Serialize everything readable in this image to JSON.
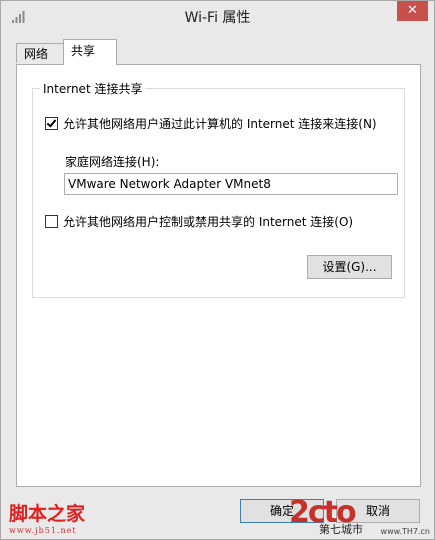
{
  "window": {
    "title": "Wi-Fi 属性",
    "close_glyph": "✕"
  },
  "tabs": [
    {
      "label": "网络"
    },
    {
      "label": "共享"
    }
  ],
  "group": {
    "title": "Internet 连接共享",
    "allow_share_label": "允许其他网络用户通过此计算机的 Internet 连接来连接(N)",
    "allow_share_checked": true,
    "home_network_label": "家庭网络连接(H):",
    "home_network_value": "VMware Network Adapter VMnet8",
    "allow_control_label": "允许其他网络用户控制或禁用共享的 Internet 连接(O)",
    "allow_control_checked": false,
    "settings_label": "设置(G)..."
  },
  "footer": {
    "ok_label": "确定",
    "cancel_label": "取消"
  },
  "watermarks": {
    "left_title": "脚本之家",
    "left_url": "www.jb51.net",
    "right_logo": "2cto",
    "right_sub": "第七城市",
    "right_site": "www.TH7.cn",
    "brand_red": "#c8302a"
  },
  "icons": {
    "title": "wifi-icon",
    "close": "close-icon",
    "check": "checkmark-icon"
  }
}
